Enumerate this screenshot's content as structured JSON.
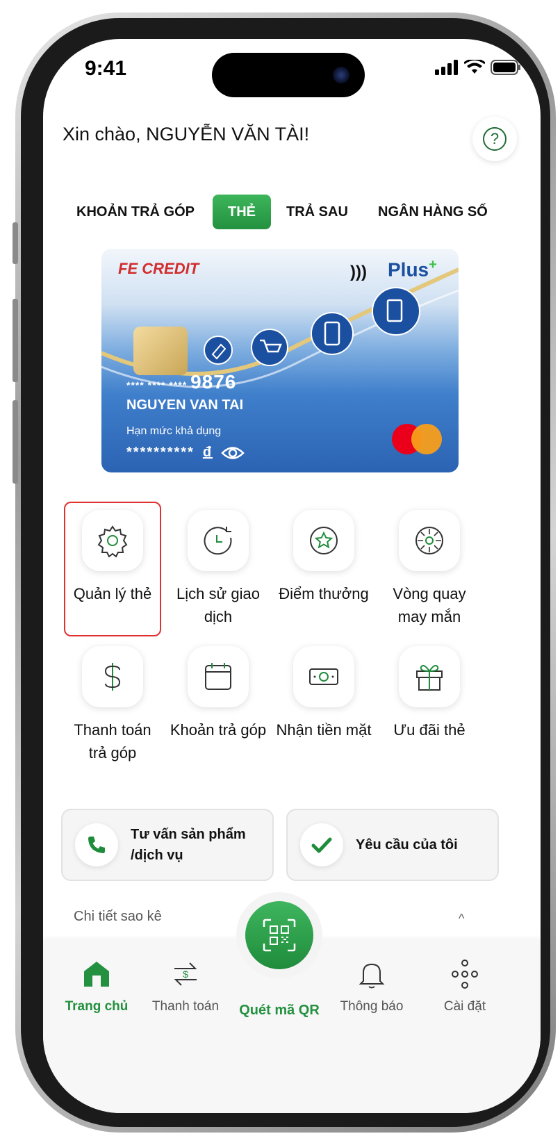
{
  "status_bar": {
    "time": "9:41"
  },
  "header": {
    "greeting": "Xin chào, NGUYỄN VĂN TÀI!",
    "help_icon": "?"
  },
  "tabs": [
    {
      "label": "KHOẢN TRẢ GÓP",
      "active": false
    },
    {
      "label": "THẺ",
      "active": true
    },
    {
      "label": "TRẢ SAU",
      "active": false
    },
    {
      "label": "NGÂN HÀNG SỐ",
      "active": false
    }
  ],
  "card": {
    "brand_fe": "FE",
    "brand_credit": "CREDIT",
    "plus": "Plus",
    "masked_prefix": "**** **** ****",
    "last_digits": "9876",
    "holder": "NGUYEN VAN TAI",
    "limit_label": "Hạn mức khả dụng",
    "limit_masked": "**********",
    "currency": "đ"
  },
  "menu": [
    {
      "label": "Quản lý thẻ",
      "icon": "gear-icon",
      "selected": true
    },
    {
      "label": "Lịch sử giao dịch",
      "icon": "history-icon",
      "selected": false
    },
    {
      "label": "Điểm thưởng",
      "icon": "star-icon",
      "selected": false
    },
    {
      "label": "Vòng quay may mắn",
      "icon": "wheel-icon",
      "selected": false
    },
    {
      "label": "Thanh toán trả góp",
      "icon": "dollar-icon",
      "selected": false
    },
    {
      "label": "Khoản trả góp",
      "icon": "calendar-icon",
      "selected": false
    },
    {
      "label": "Nhận tiền mặt",
      "icon": "cash-icon",
      "selected": false
    },
    {
      "label": "Ưu đãi thẻ",
      "icon": "gift-icon",
      "selected": false
    }
  ],
  "actions": [
    {
      "label": "Tư vấn sản phẩm /dịch vụ",
      "icon": "phone-icon"
    },
    {
      "label": "Yêu cầu của tôi",
      "icon": "check-icon"
    }
  ],
  "statement": {
    "label": "Chi tiết sao kê"
  },
  "bottom_nav": [
    {
      "label": "Trang chủ",
      "icon": "home-icon",
      "active": true
    },
    {
      "label": "Thanh toán",
      "icon": "transfer-icon",
      "active": false
    },
    {
      "label": "Quét mã QR",
      "icon": "qr-icon",
      "active": false
    },
    {
      "label": "Thông báo",
      "icon": "bell-icon",
      "active": false
    },
    {
      "label": "Cài đặt",
      "icon": "dots-icon",
      "active": false
    }
  ],
  "colors": {
    "brand_green": "#23913f",
    "highlight_red": "#e03131",
    "card_blue": "#2b63b3"
  }
}
